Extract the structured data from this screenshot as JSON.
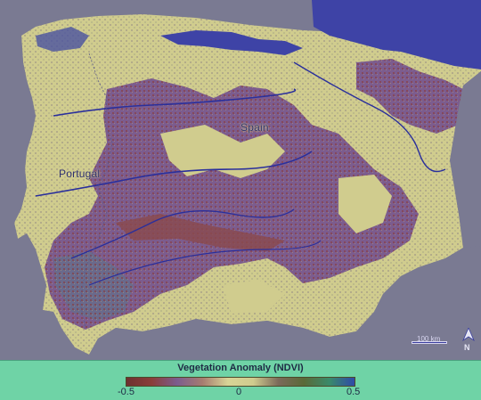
{
  "map": {
    "country_labels": {
      "spain": "Spain",
      "portugal": "Portugal"
    },
    "scale_bar": "100 km",
    "north_arrow": "N",
    "sea_color": "#7a7a92",
    "land_colors": {
      "strong_negative": "#7e3a3e",
      "negative": "#7c5c8e",
      "neutral": "#d0cc8e",
      "positive": "#3e43a6",
      "strong_positive": "#2a2f9c"
    }
  },
  "legend": {
    "title": "Vegetation Anomaly (NDVI)",
    "min_label": "-0.5",
    "mid_label": "0",
    "max_label": "0.5",
    "gradient": [
      "#6e3030",
      "#8a3e3a",
      "#7c5c8e",
      "#a77c70",
      "#d8d496",
      "#d0cc8e",
      "#7b6a5a",
      "#5a6a38",
      "#3a8a6a",
      "#2f4aa8"
    ],
    "background": "#6fd3a6"
  }
}
